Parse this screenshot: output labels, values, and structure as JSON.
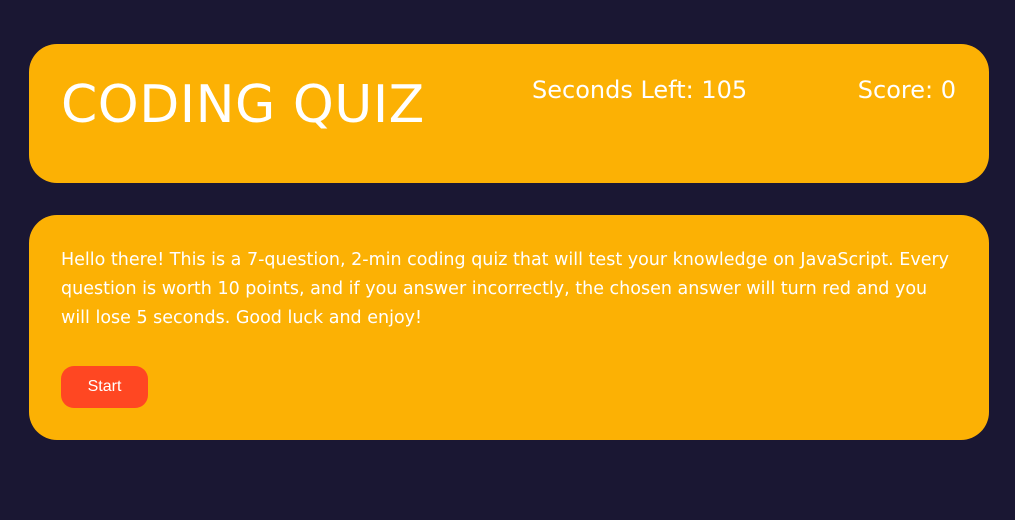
{
  "header": {
    "title": "CODING QUIZ",
    "timer_label": "Seconds Left: 105",
    "score_label": "Score: 0"
  },
  "main": {
    "intro_text": "Hello there! This is a 7-question, 2-min coding quiz that will test your knowledge on JavaScript. Every question is worth 10 points, and if you answer incorrectly, the chosen answer will turn red and you will lose 5 seconds. Good luck and enjoy!",
    "start_label": "Start"
  },
  "colors": {
    "background": "#1a1733",
    "card": "#fcb104",
    "start_button": "#ff4722",
    "text": "#ffffff"
  }
}
